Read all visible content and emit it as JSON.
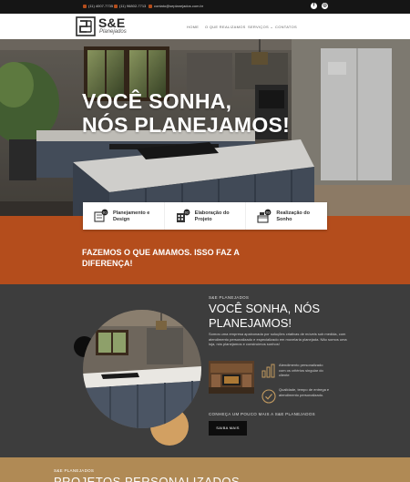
{
  "topbar": {
    "phone1": "(11) 4007-7735",
    "phone2": "(11) 96802-7713",
    "email": "contato@seplanejados.com.br",
    "social": [
      {
        "name": "facebook-icon",
        "glyph": "f"
      },
      {
        "name": "instagram-icon",
        "glyph": "◎"
      }
    ]
  },
  "header": {
    "logo_mark": "S&E",
    "logo_sub": "Planejados",
    "nav": [
      "HOME",
      "O QUE REALIZAMOS",
      "SERVIÇOS ⌄",
      "CONTATOS"
    ]
  },
  "hero": {
    "title_line1": "VOCÊ SONHA,",
    "title_line2": "NÓS PLANEJAMOS!"
  },
  "features": [
    {
      "label": "Planejamento e Design",
      "icon": "blueprint-icon"
    },
    {
      "label": "Elaboração do Projeto",
      "icon": "building-icon"
    },
    {
      "label": "Realização do Sonho",
      "icon": "kitchen-icon"
    }
  ],
  "band": {
    "text": "FAZEMOS O QUE AMAMOS. ISSO FAZ A DIFERENÇA!"
  },
  "about": {
    "kicker": "S&E PLANEJADOS",
    "title": "VOCÊ SONHA, NÓS PLANEJAMOS!",
    "description": "Somos uma empresa apaixonada por soluções criativas de móveis sob medida, com atendimento personalizado e especializado em movelaria planejada. Não somos uma loja, nós planejamos e construímos sonhos!",
    "items": [
      {
        "text": "Atendimento personalizado com os critérios singular do cliente",
        "icon": "chart-icon"
      },
      {
        "text": "Qualidade, tempo de entrega e atendimento personalizado.",
        "icon": "check-circle-icon"
      }
    ],
    "cta_text": "CONHEÇA UM POUCO MAIS A S&E PLANEJADOS",
    "button_label": "SAIBA MAIS"
  },
  "projects": {
    "kicker": "S&E PLANEJADOS",
    "title": "PROJETOS PERSONALIZADOS"
  },
  "colors": {
    "accent": "#b44d1c",
    "dark": "#3d3d3d",
    "tan": "#d2a062"
  }
}
